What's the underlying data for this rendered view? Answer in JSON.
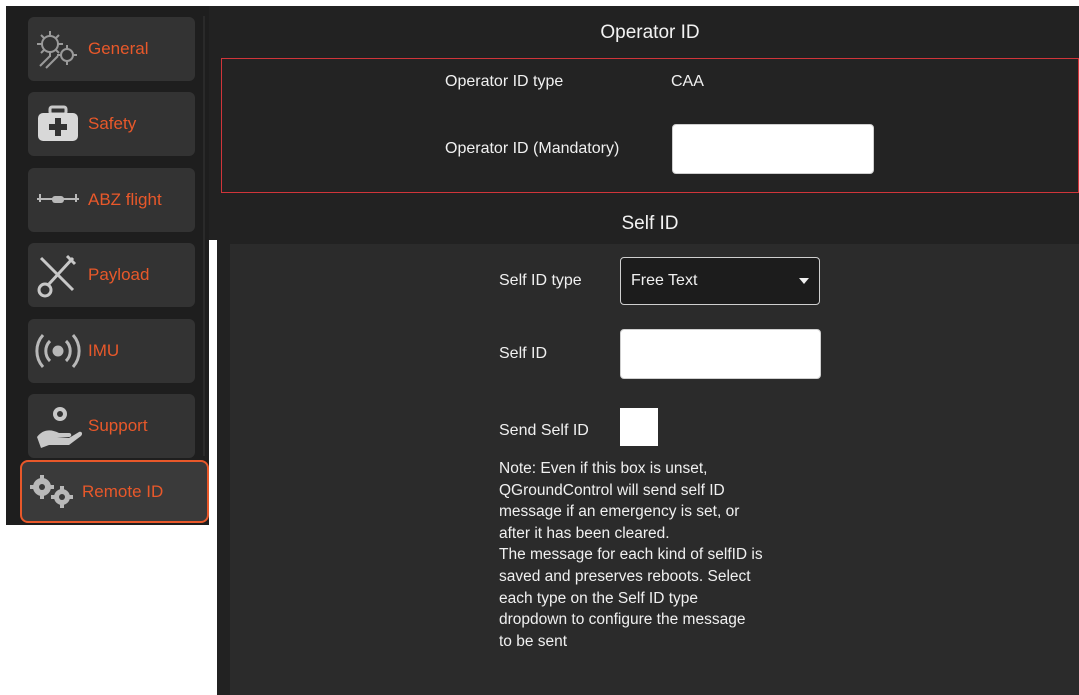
{
  "nav": {
    "items": [
      {
        "label": "General",
        "icon": "wrench-gears-icon"
      },
      {
        "label": "Safety",
        "icon": "first-aid-kit-icon"
      },
      {
        "label": "ABZ flight",
        "icon": "drone-icon"
      },
      {
        "label": "Payload",
        "icon": "tools-icon"
      },
      {
        "label": "IMU",
        "icon": "signal-broadcast-icon"
      },
      {
        "label": "Support",
        "icon": "hand-gear-icon"
      },
      {
        "label": "Remote ID",
        "icon": "gears-icon"
      }
    ],
    "active": "Remote ID",
    "accent_color": "#e8582a"
  },
  "operator": {
    "title": "Operator ID",
    "type_label": "Operator ID type",
    "type_value": "CAA",
    "id_label": "Operator ID (Mandatory)",
    "id_value": "",
    "border_color": "#d0353a"
  },
  "self": {
    "title": "Self ID",
    "type_label": "Self ID type",
    "type_value": "Free Text",
    "id_label": "Self ID",
    "id_value": "",
    "send_label": "Send Self ID",
    "send_checked": false,
    "note": "Note: Even if this box is unset,\nQGroundControl will send self ID\nmessage if an emergency is set, or\nafter it has been cleared.\nThe message for each kind of selfID is\nsaved and preserves reboots. Select\neach type on the Self ID type\ndropdown to configure the message\nto be sent"
  }
}
